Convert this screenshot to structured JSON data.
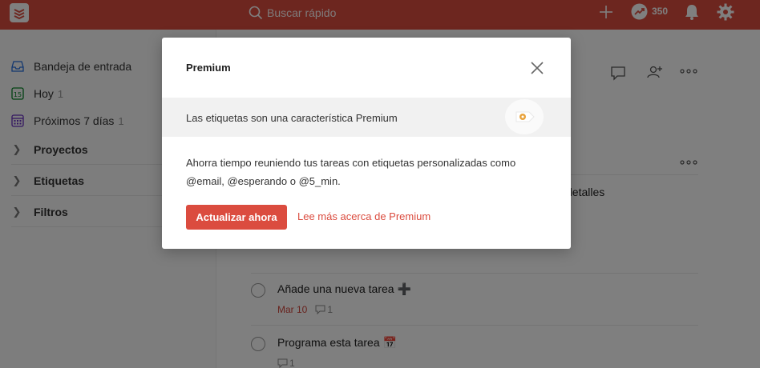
{
  "header": {
    "search_placeholder": "Buscar rápido",
    "karma": "350"
  },
  "sidebar": {
    "items": [
      {
        "label": "Bandeja de entrada",
        "count": ""
      },
      {
        "label": "Hoy",
        "count": "1",
        "icon_text": "15"
      },
      {
        "label": "Próximos 7 días",
        "count": "1"
      }
    ],
    "groups": [
      {
        "label": "Proyectos"
      },
      {
        "label": "Etiquetas"
      },
      {
        "label": "Filtros"
      }
    ]
  },
  "main": {
    "partial_text": "detalles",
    "tasks": [
      {
        "title": "Añade una nueva tarea ➕",
        "due": "Mar 10",
        "comments": "1"
      },
      {
        "title": "Programa esta tarea 📅",
        "due": "",
        "comments": "1"
      }
    ]
  },
  "modal": {
    "title": "Premium",
    "band_text": "Las etiquetas son una característica Premium",
    "body": "Ahorra tiempo reuniendo tus tareas con etiquetas personalizadas como @email, @esperando o @5_min.",
    "upgrade_label": "Actualizar ahora",
    "learn_label": "Lee más acerca de Premium"
  },
  "colors": {
    "brand": "#db4c3f",
    "overlay": "rgba(0,0,0,0.5)"
  }
}
